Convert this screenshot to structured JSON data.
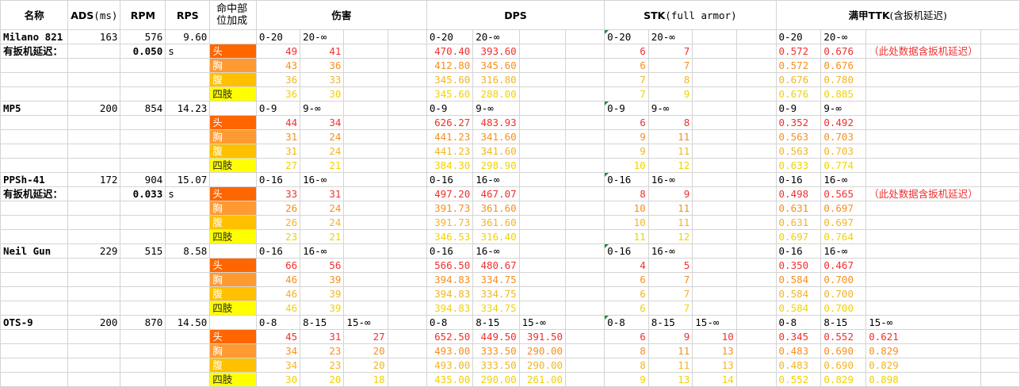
{
  "colors": {
    "head_bg": "#ff6600",
    "chest_bg": "#ff9a33",
    "belly_bg": "#ffc000",
    "limb_bg": "#ffff00",
    "row_red": "#f0302f",
    "row_orange": "#f59020",
    "row_amber": "#f2b526",
    "row_yellow": "#f2d200",
    "comment_marker": "#1a8e3c"
  },
  "header": {
    "name": "名称",
    "ads": "ADS",
    "ads_unit": "(ms)",
    "rpm": "RPM",
    "rps": "RPS",
    "body_part": "命中部位加成",
    "damage": "伤害",
    "dps": "DPS",
    "stk": "STK",
    "stk_note": "(full armor)",
    "ttk": "满甲TTK",
    "ttk_note": "(含扳机延迟)"
  },
  "parts": [
    "头",
    "胸",
    "腹",
    "四肢"
  ],
  "trigger_label": "有扳机延迟：",
  "trigger_unit": "s",
  "remark": "（此处数据含扳机延迟）",
  "weapons": [
    {
      "name": "Milano 821",
      "ads": "163",
      "rpm": "576",
      "rps": "9.60",
      "trigger": "0.050",
      "ranges": [
        "0-20",
        "20-∞"
      ],
      "damage": [
        [
          "49",
          "41"
        ],
        [
          "43",
          "36"
        ],
        [
          "36",
          "33"
        ],
        [
          "36",
          "30"
        ]
      ],
      "dps": [
        [
          "470.40",
          "393.60"
        ],
        [
          "412.80",
          "345.60"
        ],
        [
          "345.60",
          "316.80"
        ],
        [
          "345.60",
          "288.00"
        ]
      ],
      "stk": [
        [
          "6",
          "7"
        ],
        [
          "6",
          "7"
        ],
        [
          "7",
          "8"
        ],
        [
          "7",
          "9"
        ]
      ],
      "ttk": [
        [
          "0.572",
          "0.676"
        ],
        [
          "0.572",
          "0.676"
        ],
        [
          "0.676",
          "0.780"
        ],
        [
          "0.676",
          "0.885"
        ]
      ]
    },
    {
      "name": "MP5",
      "ads": "200",
      "rpm": "854",
      "rps": "14.23",
      "ranges": [
        "0-9",
        "9-∞"
      ],
      "damage": [
        [
          "44",
          "34"
        ],
        [
          "31",
          "24"
        ],
        [
          "31",
          "24"
        ],
        [
          "27",
          "21"
        ]
      ],
      "dps": [
        [
          "626.27",
          "483.93"
        ],
        [
          "441.23",
          "341.60"
        ],
        [
          "441.23",
          "341.60"
        ],
        [
          "384.30",
          "298.90"
        ]
      ],
      "stk": [
        [
          "6",
          "8"
        ],
        [
          "9",
          "11"
        ],
        [
          "9",
          "11"
        ],
        [
          "10",
          "12"
        ]
      ],
      "ttk": [
        [
          "0.352",
          "0.492"
        ],
        [
          "0.563",
          "0.703"
        ],
        [
          "0.563",
          "0.703"
        ],
        [
          "0.633",
          "0.774"
        ]
      ]
    },
    {
      "name": "PPSh-41",
      "ads": "172",
      "rpm": "904",
      "rps": "15.07",
      "trigger": "0.033",
      "ranges": [
        "0-16",
        "16-∞"
      ],
      "damage": [
        [
          "33",
          "31"
        ],
        [
          "26",
          "24"
        ],
        [
          "26",
          "24"
        ],
        [
          "23",
          "21"
        ]
      ],
      "dps": [
        [
          "497.20",
          "467.07"
        ],
        [
          "391.73",
          "361.60"
        ],
        [
          "391.73",
          "361.60"
        ],
        [
          "346.53",
          "316.40"
        ]
      ],
      "stk": [
        [
          "8",
          "9"
        ],
        [
          "10",
          "11"
        ],
        [
          "10",
          "11"
        ],
        [
          "11",
          "12"
        ]
      ],
      "ttk": [
        [
          "0.498",
          "0.565"
        ],
        [
          "0.631",
          "0.697"
        ],
        [
          "0.631",
          "0.697"
        ],
        [
          "0.697",
          "0.764"
        ]
      ]
    },
    {
      "name": "Neil Gun",
      "ads": "229",
      "rpm": "515",
      "rps": "8.58",
      "ranges": [
        "0-16",
        "16-∞"
      ],
      "damage": [
        [
          "66",
          "56"
        ],
        [
          "46",
          "39"
        ],
        [
          "46",
          "39"
        ],
        [
          "46",
          "39"
        ]
      ],
      "dps": [
        [
          "566.50",
          "480.67"
        ],
        [
          "394.83",
          "334.75"
        ],
        [
          "394.83",
          "334.75"
        ],
        [
          "394.83",
          "334.75"
        ]
      ],
      "stk": [
        [
          "4",
          "5"
        ],
        [
          "6",
          "7"
        ],
        [
          "6",
          "7"
        ],
        [
          "6",
          "7"
        ]
      ],
      "ttk": [
        [
          "0.350",
          "0.467"
        ],
        [
          "0.584",
          "0.700"
        ],
        [
          "0.584",
          "0.700"
        ],
        [
          "0.584",
          "0.700"
        ]
      ]
    },
    {
      "name": "OTS-9",
      "ads": "200",
      "rpm": "870",
      "rps": "14.50",
      "ranges": [
        "0-8",
        "8-15",
        "15-∞"
      ],
      "damage": [
        [
          "45",
          "31",
          "27"
        ],
        [
          "34",
          "23",
          "20"
        ],
        [
          "34",
          "23",
          "20"
        ],
        [
          "30",
          "20",
          "18"
        ]
      ],
      "dps": [
        [
          "652.50",
          "449.50",
          "391.50"
        ],
        [
          "493.00",
          "333.50",
          "290.00"
        ],
        [
          "493.00",
          "333.50",
          "290.00"
        ],
        [
          "435.00",
          "290.00",
          "261.00"
        ]
      ],
      "stk": [
        [
          "6",
          "9",
          "10"
        ],
        [
          "8",
          "11",
          "13"
        ],
        [
          "8",
          "11",
          "13"
        ],
        [
          "9",
          "13",
          "14"
        ]
      ],
      "ttk": [
        [
          "0.345",
          "0.552",
          "0.621"
        ],
        [
          "0.483",
          "0.690",
          "0.829"
        ],
        [
          "0.483",
          "0.690",
          "0.829"
        ],
        [
          "0.552",
          "0.829",
          "0.898"
        ]
      ]
    }
  ]
}
